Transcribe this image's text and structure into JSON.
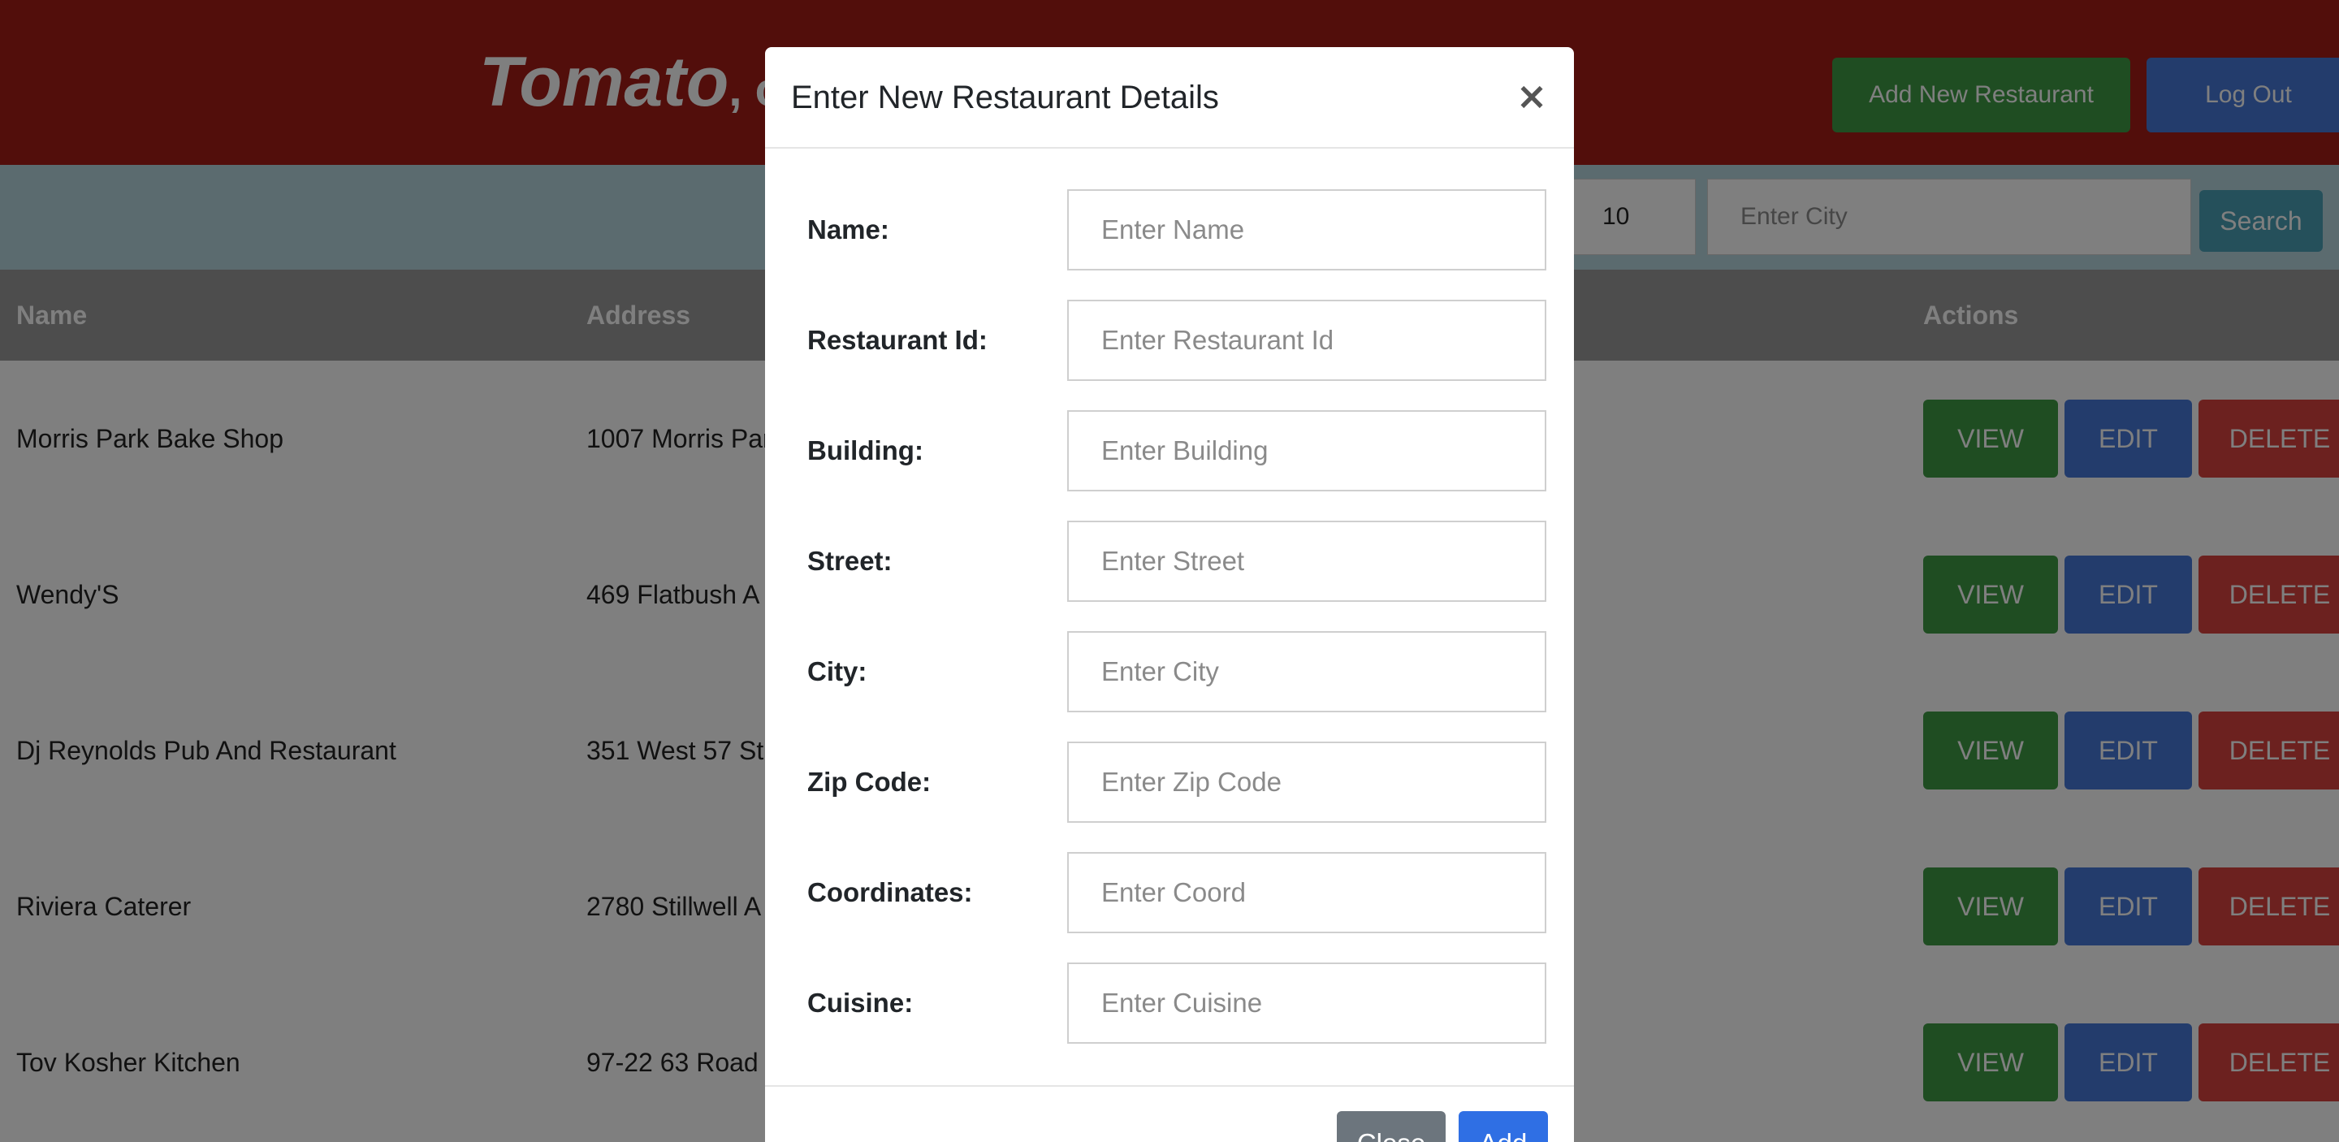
{
  "header": {
    "brand": "Tomato",
    "tagline": ", or",
    "add_button": "Add New Restaurant",
    "logout_button": "Log Out",
    "colors": {
      "header_bg": "#a51d16",
      "green": "#3f9a45",
      "blue": "#4679d9"
    }
  },
  "search": {
    "limit_value": "10",
    "city_placeholder": "Enter City",
    "search_button": "Search"
  },
  "table": {
    "columns": {
      "name": "Name",
      "address": "Address",
      "actions": "Actions"
    },
    "rows": [
      {
        "name": "Morris Park Bake Shop",
        "address": "1007 Morris Par"
      },
      {
        "name": "Wendy'S",
        "address": "469 Flatbush A"
      },
      {
        "name": "Dj Reynolds Pub And Restaurant",
        "address": "351 West 57 St"
      },
      {
        "name": "Riviera Caterer",
        "address": "2780 Stillwell A"
      },
      {
        "name": "Tov Kosher Kitchen",
        "address": "97-22 63 Road"
      }
    ],
    "actions": {
      "view": "VIEW",
      "edit": "EDIT",
      "delete": "DELETE"
    }
  },
  "modal": {
    "title": "Enter New Restaurant Details",
    "close_icon": "×",
    "fields": [
      {
        "label": "Name:",
        "placeholder": "Enter Name"
      },
      {
        "label": "Restaurant Id:",
        "placeholder": "Enter Restaurant Id"
      },
      {
        "label": "Building:",
        "placeholder": "Enter Building"
      },
      {
        "label": "Street:",
        "placeholder": "Enter Street"
      },
      {
        "label": "City:",
        "placeholder": "Enter City"
      },
      {
        "label": "Zip Code:",
        "placeholder": "Enter Zip Code"
      },
      {
        "label": "Coordinates:",
        "placeholder": "Enter Coord"
      },
      {
        "label": "Cuisine:",
        "placeholder": "Enter Cuisine"
      }
    ],
    "close_button": "Close",
    "add_button": "Add"
  }
}
